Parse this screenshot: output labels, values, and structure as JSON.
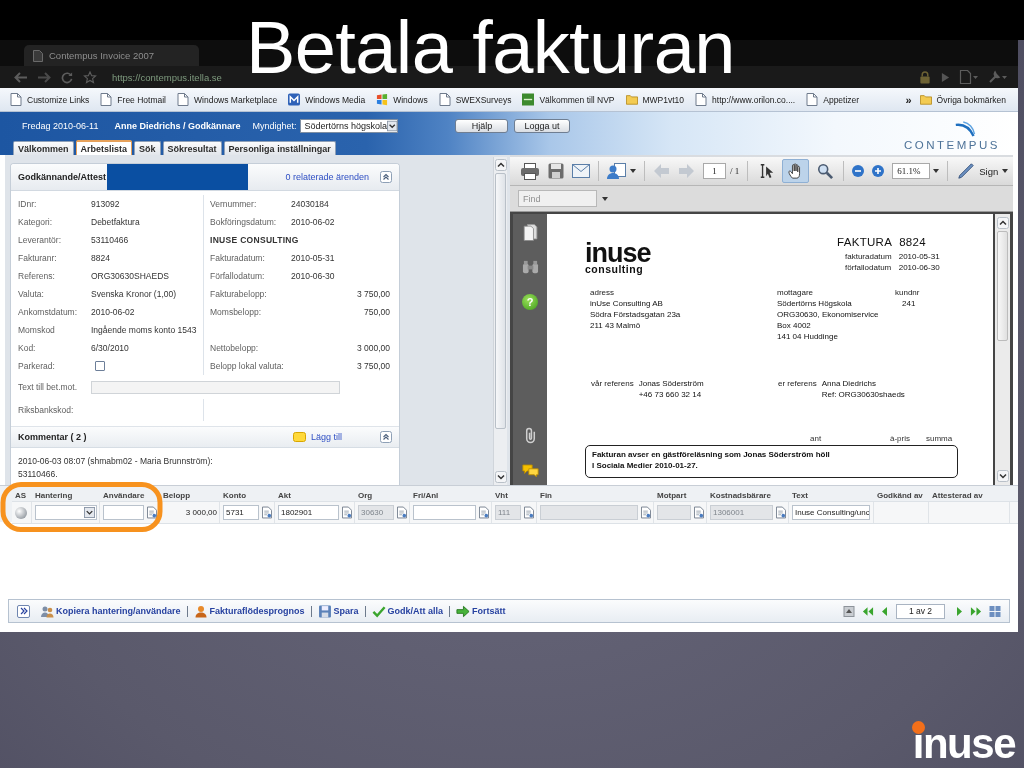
{
  "slide": {
    "title": "Betala fakturan",
    "brand": "inuse"
  },
  "browser": {
    "tab_title": "Contempus Invoice 2007",
    "url": "https://contempus.itella.se"
  },
  "bookmarks": [
    {
      "label": "Customize Links",
      "kind": "page"
    },
    {
      "label": "Free Hotmail",
      "kind": "page"
    },
    {
      "label": "Windows Marketplace",
      "kind": "page"
    },
    {
      "label": "Windows Media",
      "kind": "media"
    },
    {
      "label": "Windows",
      "kind": "windows"
    },
    {
      "label": "SWEXSurveys",
      "kind": "page"
    },
    {
      "label": "Välkommen till NVP",
      "kind": "nvp"
    },
    {
      "label": "MWP1vt10",
      "kind": "folder"
    },
    {
      "label": "http://www.orilon.co....",
      "kind": "page"
    },
    {
      "label": "Appetizer",
      "kind": "page"
    }
  ],
  "bookmarks_overflow": "»",
  "other_bookmarks": "Övriga bokmärken",
  "app_header": {
    "date": "Fredag 2010-06-11",
    "user": "Anne Diedrichs / Godkännare",
    "authority_label": "Myndighet:",
    "authority": "Södertörns högskola",
    "buttons": [
      "Hjälp",
      "Logga ut"
    ],
    "logo": "CONTEMPUS"
  },
  "tabs": [
    {
      "label": "Välkommen",
      "selected": false
    },
    {
      "label": "Arbetslista",
      "selected": true
    },
    {
      "label": "Sök",
      "selected": false
    },
    {
      "label": "Sökresultat",
      "selected": false
    },
    {
      "label": "Personliga inställningar",
      "selected": false
    }
  ],
  "approval": {
    "title": "Godkännande/Attest",
    "related_link": "0 relaterade ärenden",
    "rows": [
      {
        "left": {
          "label": "IDnr:",
          "value": "913092",
          "kind": "text"
        },
        "right": {
          "label": "Vernummer:",
          "value": "24030184",
          "kind": "text"
        }
      },
      {
        "left": {
          "label": "Kategori:",
          "value": "Debetfaktura",
          "kind": "text"
        },
        "right": {
          "label": "Bokföringsdatum:",
          "value": "2010-06-02",
          "kind": "text"
        }
      },
      {
        "left": {
          "label": "Leverantör:",
          "value": "53110466",
          "kind": "text"
        },
        "right": {
          "value": "INUSE CONSULTING",
          "kind": "heading"
        }
      },
      {
        "left": {
          "label": "Fakturanr:",
          "value": "8824",
          "kind": "text"
        },
        "right": {
          "label": "Fakturadatum:",
          "value": "2010-05-31",
          "kind": "text"
        }
      },
      {
        "left": {
          "label": "Referens:",
          "value": "ORG30630SHAEDS",
          "kind": "text"
        },
        "right": {
          "label": "Förfallodatum:",
          "value": "2010-06-30",
          "kind": "text"
        }
      },
      {
        "left": {
          "label": "Valuta:",
          "value": "Svenska Kronor (1,00)",
          "kind": "text"
        },
        "right": {
          "label": "Fakturabelopp:",
          "value": "3 750,00",
          "kind": "amount"
        }
      },
      {
        "left": {
          "label": "Ankomstdatum:",
          "value": "2010-06-02",
          "kind": "text"
        },
        "right": {
          "label": "Momsbelopp:",
          "value": "750,00",
          "kind": "amount"
        }
      },
      {
        "left": {
          "label": "Momskod",
          "value": "Ingående moms konto 1543",
          "kind": "text"
        }
      },
      {
        "left": {
          "label": "Kod:",
          "value": "6/30/2010",
          "kind": "text"
        },
        "right": {
          "label": "Nettobelopp:",
          "value": "3 000,00",
          "kind": "amount"
        }
      },
      {
        "left": {
          "label": "Parkerad:",
          "kind": "checkbox",
          "checked": false
        },
        "right": {
          "label": "Belopp lokal valuta:",
          "value": "3 750,00",
          "kind": "amount"
        }
      }
    ],
    "payee_text_label": "Text till bet.mot.",
    "bank_code_label": "Riksbankskod:"
  },
  "comments": {
    "title": "Kommentar ( 2 )",
    "add_link": "Lägg till",
    "lines": [
      "2010-06-03 08:07 (shmabm02 - Maria Brunnström):",
      "53110466."
    ]
  },
  "pdf": {
    "page": "1",
    "page_count": "/ 1",
    "zoom": "61.1%",
    "sign": "Sign",
    "find_placeholder": "Find",
    "help": "?",
    "tools": [
      {
        "kind": "select",
        "selected": false
      },
      {
        "kind": "hand",
        "selected": true
      },
      {
        "kind": "marquee",
        "selected": false
      }
    ]
  },
  "invoice": {
    "logo": "inuse",
    "logo_sub": "consulting",
    "heading": "FAKTURA",
    "number": "8824",
    "dates": [
      {
        "label": "fakturadatum",
        "value": "2010-05-31"
      },
      {
        "label": "förfallodatum",
        "value": "2010-06-30"
      }
    ],
    "sender": {
      "label": "adress",
      "lines": [
        "inUse Consulting AB",
        "Södra Förstadsgatan 23a",
        "211 43 Malmö"
      ]
    },
    "recipient": {
      "label": "mottagare",
      "lines": [
        "Södertörns Högskola",
        "ORG30630, Ekonomiservice",
        "Box 4002",
        "141 04 Huddinge"
      ]
    },
    "customer": {
      "label": "kundnr",
      "value": "241"
    },
    "references": [
      {
        "label": "vår referens",
        "lines": [
          "Jonas Söderström",
          "+46 73 660 32 14"
        ]
      },
      {
        "label": "er referens",
        "lines": [
          "Anna Diedrichs",
          "Ref: ORG30630shaeds"
        ]
      }
    ],
    "item_columns": [
      "ant",
      "à-pris",
      "summa"
    ],
    "description": [
      "Fakturan avser en gästföreläsning som Jonas Söderström höll",
      "I Sociala Medier 2010-01-27."
    ]
  },
  "grid": {
    "columns": [
      {
        "label": "AS",
        "cell": {
          "kind": "status"
        }
      },
      {
        "label": "Hantering",
        "cell": {
          "kind": "select",
          "disabled": false
        }
      },
      {
        "label": "Användare",
        "cell": {
          "kind": "lookup",
          "disabled": false
        }
      },
      {
        "label": "Belopp",
        "cell": {
          "kind": "amount",
          "value": "3 000,00"
        }
      },
      {
        "label": "Konto",
        "cell": {
          "kind": "lookup",
          "value": "5731",
          "disabled": false
        }
      },
      {
        "label": "Akt",
        "cell": {
          "kind": "lookup",
          "value": "1802901",
          "disabled": false
        }
      },
      {
        "label": "Org",
        "cell": {
          "kind": "lookup",
          "value": "30630",
          "disabled": true
        }
      },
      {
        "label": "Fri/Anl",
        "cell": {
          "kind": "lookup",
          "disabled": false
        }
      },
      {
        "label": "Vht",
        "cell": {
          "kind": "lookup",
          "value": "111",
          "disabled": true
        }
      },
      {
        "label": "Fin",
        "cell": {
          "kind": "lookup",
          "disabled": true
        }
      },
      {
        "label": "Motpart",
        "cell": {
          "kind": "lookup",
          "disabled": true
        }
      },
      {
        "label": "Kostnadsbärare",
        "cell": {
          "kind": "lookup",
          "value": "1306001",
          "disabled": true
        }
      },
      {
        "label": "Text",
        "cell": {
          "kind": "text",
          "value": "Inuse Consulting/unc",
          "disabled": false
        }
      },
      {
        "label": "Godkänd av"
      },
      {
        "label": "Attesterad av"
      }
    ]
  },
  "toolbar": {
    "actions": [
      {
        "label": "Kopiera hantering/användare",
        "kind": "copy"
      },
      {
        "label": "Fakturaflödesprognos",
        "kind": "forecast"
      },
      {
        "label": "Spara",
        "kind": "save"
      },
      {
        "label": "Godk/Att alla",
        "kind": "approve"
      },
      {
        "label": "Fortsätt",
        "kind": "continue"
      }
    ],
    "pager": "1 av 2"
  }
}
